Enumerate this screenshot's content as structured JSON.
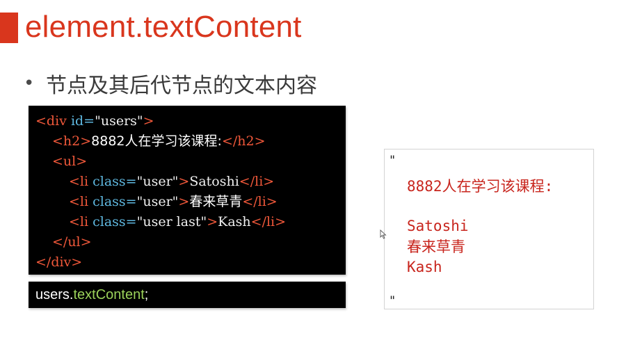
{
  "slide": {
    "title": "element.textContent",
    "bullet": "节点及其后代节点的文本内容"
  },
  "code": {
    "line1": {
      "open": "<div ",
      "attr": "id=",
      "val": "\"users\"",
      "close": ">"
    },
    "line2": {
      "open": "<h2>",
      "text": "8882人在学习该课程:",
      "close": "</h2>"
    },
    "line3": {
      "tag": "<ul>"
    },
    "line4": {
      "open": "<li ",
      "attr": "class=",
      "val": "\"user\"",
      "close": ">",
      "text": "Satoshi",
      "end": "</li>"
    },
    "line5": {
      "open": "<li ",
      "attr": "class=",
      "val": "\"user\"",
      "close": ">",
      "text": "春来草青",
      "end": "</li>"
    },
    "line6": {
      "open": "<li ",
      "attr": "class=",
      "val": "\"user last\"",
      "close": ">",
      "text": "Kash",
      "end": "</li>"
    },
    "line7": {
      "tag": "</ul>"
    },
    "line8": {
      "tag": "</div>"
    }
  },
  "command": {
    "object": "users.",
    "property": "textContent",
    "terminator": ";"
  },
  "output": {
    "open_quote": "\"",
    "heading": "8882人在学习该课程:",
    "items": [
      "Satoshi",
      "春来草青",
      "Kash"
    ],
    "close_quote": "\""
  },
  "colors": {
    "accent": "#d9361d",
    "tag": "#f0583a",
    "attr": "#5fb8e0",
    "output_text": "#c8251d",
    "property": "#9bd25a"
  }
}
